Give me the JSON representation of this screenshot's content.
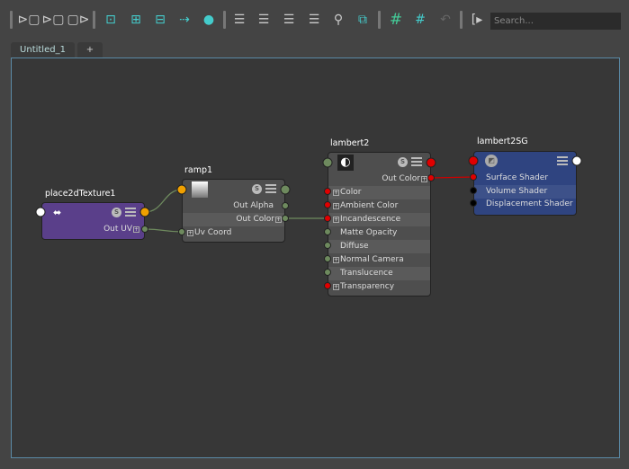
{
  "toolbar": {
    "icons": [
      "input-connections-icon",
      "input-output-connections-icon",
      "output-connections-icon",
      "frame-all-icon",
      "add-selected-icon",
      "remove-selected-icon",
      "graph-downstream-icon",
      "graph-upstream-icon",
      "simple-mode-icon",
      "connected-mode-icon",
      "full-mode-icon",
      "custom-mode-icon",
      "search-icon",
      "toggle-swatch-icon",
      "grid-icon",
      "snap-to-grid-icon",
      "reload-icon",
      "pin-icon"
    ],
    "search_placeholder": "Search..."
  },
  "tabs": [
    {
      "label": "Untitled_1"
    },
    {
      "label": "+"
    }
  ],
  "nodes": {
    "place2d": {
      "title": "place2dTexture1",
      "color": "#5a3f8a",
      "out_uv": "Out UV"
    },
    "ramp": {
      "title": "ramp1",
      "out_alpha": "Out Alpha",
      "out_color": "Out Color",
      "uv_coord": "Uv Coord"
    },
    "lambert": {
      "title": "lambert2",
      "out_color": "Out Color",
      "attrs": [
        "Color",
        "Ambient Color",
        "Incandescence",
        "Matte Opacity",
        "Diffuse",
        "Normal Camera",
        "Translucence",
        "Transparency"
      ]
    },
    "sg": {
      "title": "lambert2SG",
      "color": "#2f4480",
      "attrs": [
        "Surface Shader",
        "Volume Shader",
        "Displacement Shader"
      ]
    }
  },
  "colors": {
    "port_color": "#e00000",
    "port_float": "#6e8a5e",
    "port_uv": "#f0a000",
    "accent": "#5b8aa6"
  }
}
